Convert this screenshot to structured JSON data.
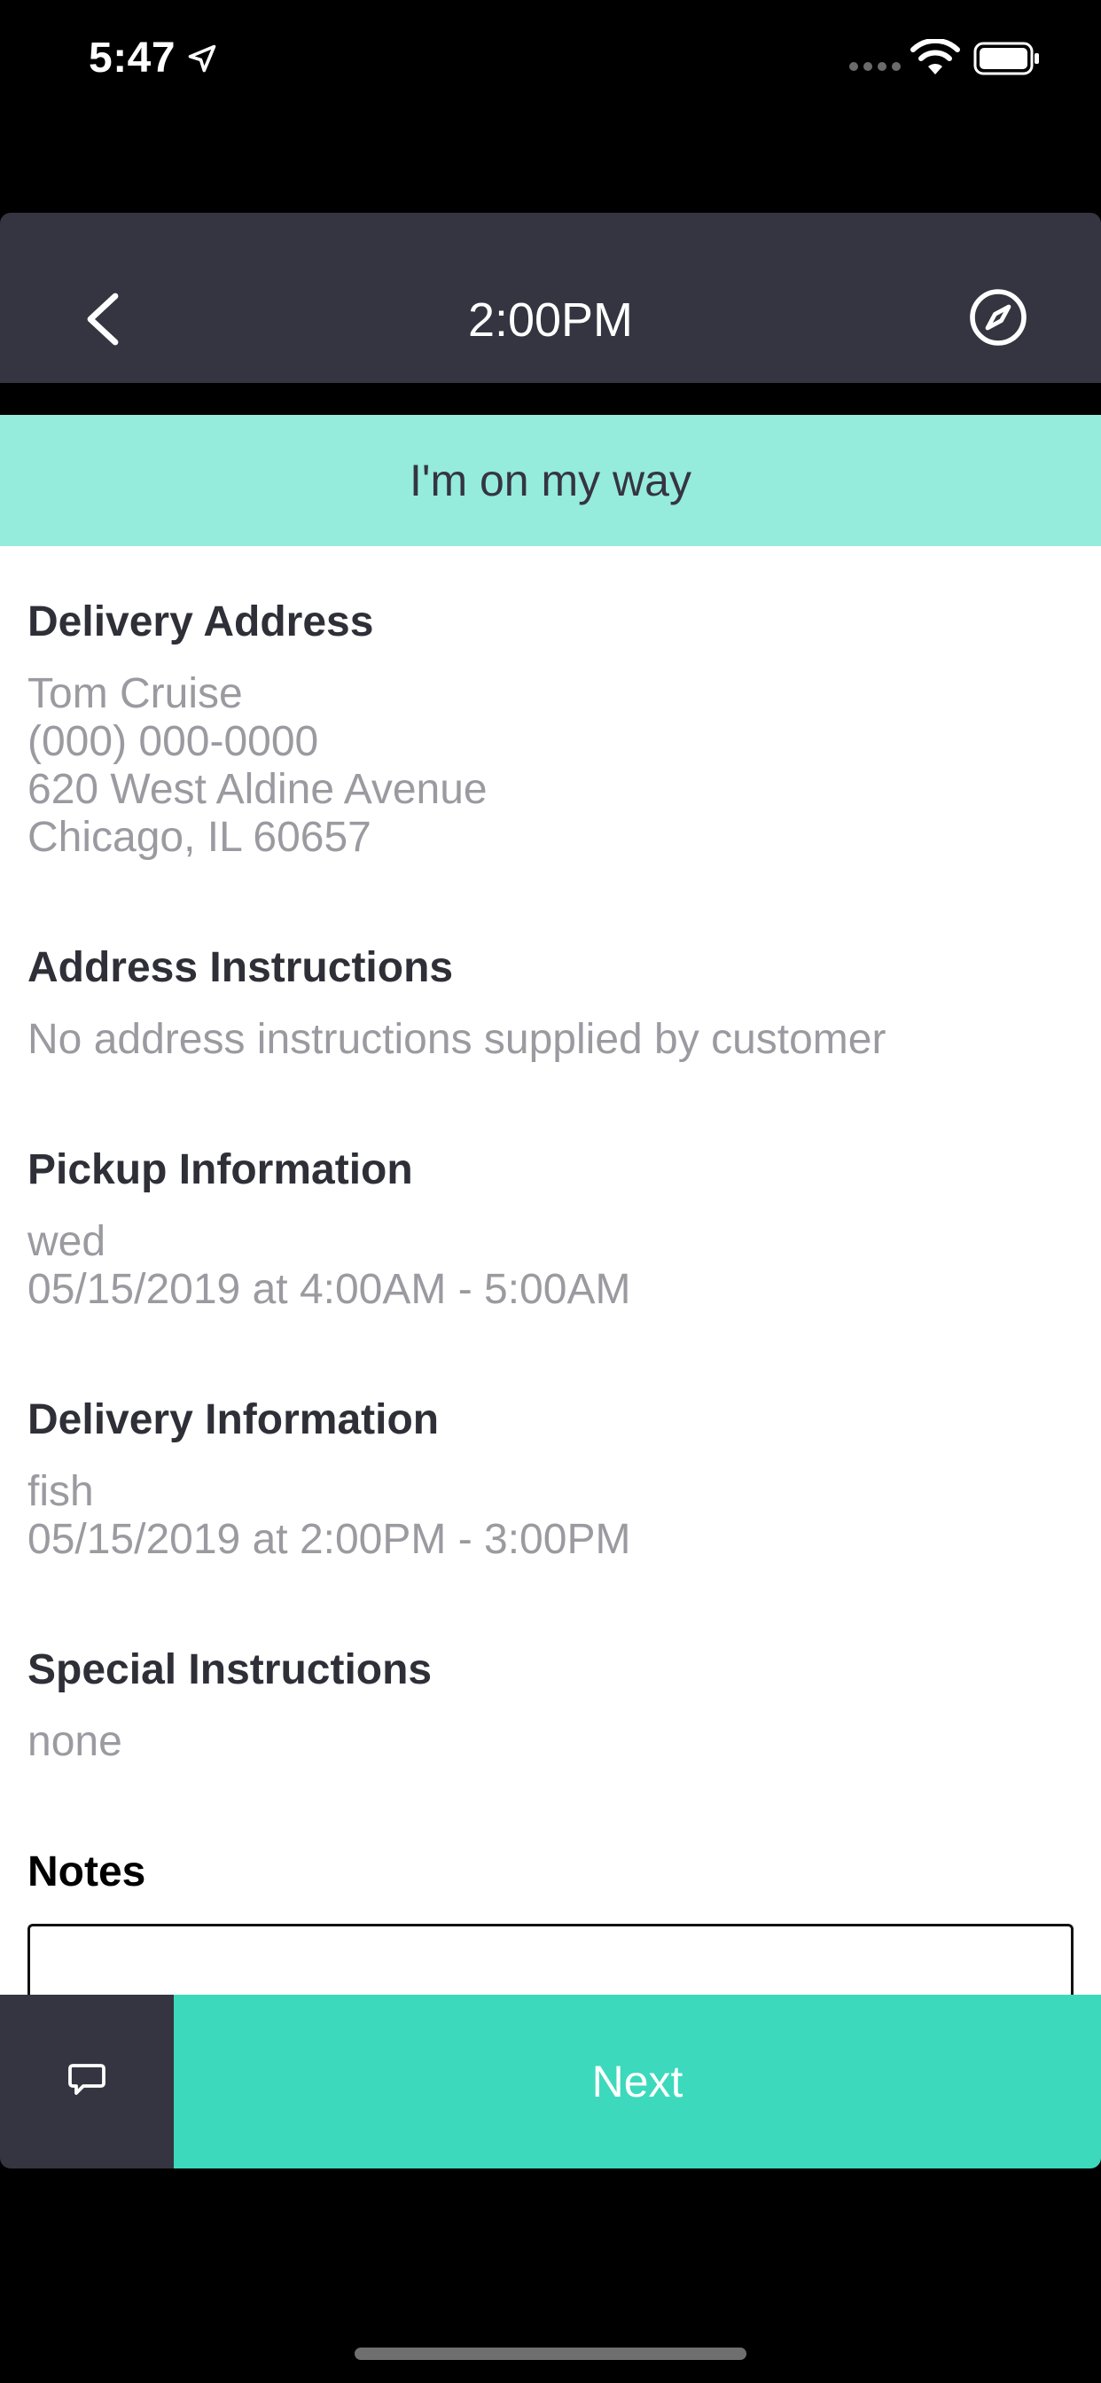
{
  "status_bar": {
    "time": "5:47",
    "icons": [
      "location-arrow-icon",
      "signal-icon",
      "wifi-icon",
      "battery-icon"
    ]
  },
  "header": {
    "title": "2:00PM",
    "back_icon": "chevron-left-icon",
    "navigate_icon": "compass-icon"
  },
  "banner": {
    "label": "I'm on my way"
  },
  "sections": {
    "delivery_address": {
      "title": "Delivery Address",
      "name": "Tom Cruise",
      "phone": "(000) 000-0000",
      "street": "620 West Aldine Avenue",
      "city": "Chicago, IL 60657"
    },
    "address_instructions": {
      "title": "Address Instructions",
      "text": "No address instructions supplied by customer"
    },
    "pickup_information": {
      "title": "Pickup Information",
      "day": "wed",
      "window": "05/15/2019 at 4:00AM - 5:00AM"
    },
    "delivery_information": {
      "title": "Delivery Information",
      "note": "fish",
      "window": "05/15/2019 at 2:00PM - 3:00PM"
    },
    "special_instructions": {
      "title": "Special Instructions",
      "text": "none"
    },
    "notes": {
      "title": "Notes",
      "value": ""
    }
  },
  "bottom_bar": {
    "chat_icon": "chat-bubble-icon",
    "next_label": "Next"
  },
  "colors": {
    "header_bg": "#353541",
    "banner_bg": "#95ebdc",
    "accent": "#3dd9bc",
    "body_text": "#9a9aa0"
  }
}
